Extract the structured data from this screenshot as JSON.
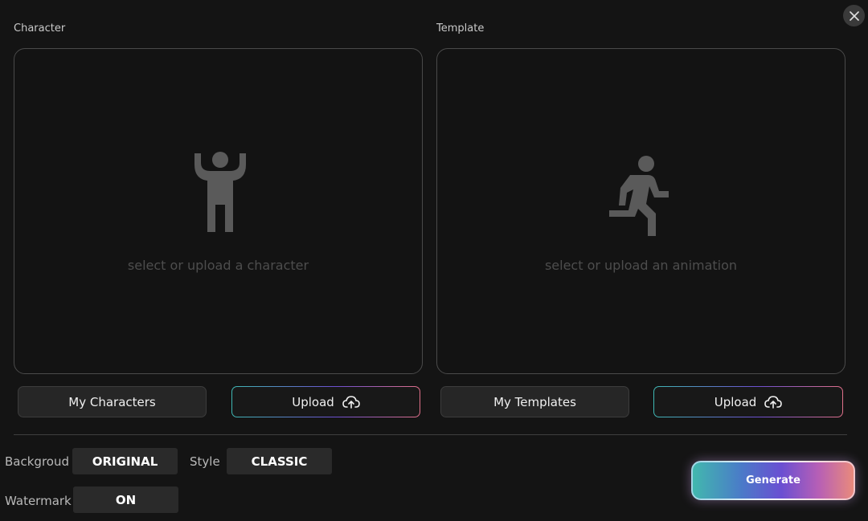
{
  "character": {
    "section_label": "Character",
    "placeholder": "select or upload a character",
    "my_button": "My Characters",
    "upload_button": "Upload"
  },
  "template": {
    "section_label": "Template",
    "placeholder": "select or upload an animation",
    "my_button": "My Templates",
    "upload_button": "Upload"
  },
  "options": {
    "background_label": "Backgroud",
    "background_value": "ORIGINAL",
    "style_label": "Style",
    "style_value": "CLASSIC",
    "watermark_label": "Watermark",
    "watermark_value": "ON"
  },
  "generate_button": "Generate",
  "icons": {
    "close": "close-icon",
    "character": "person-arms-up-icon",
    "template": "running-person-icon",
    "upload": "cloud-upload-icon"
  },
  "colors": {
    "background": "#141414",
    "panel_border": "#4a4a4a",
    "generate_gradient": [
      "#42b8ae",
      "#6a4fd2",
      "#e98a7c"
    ]
  }
}
